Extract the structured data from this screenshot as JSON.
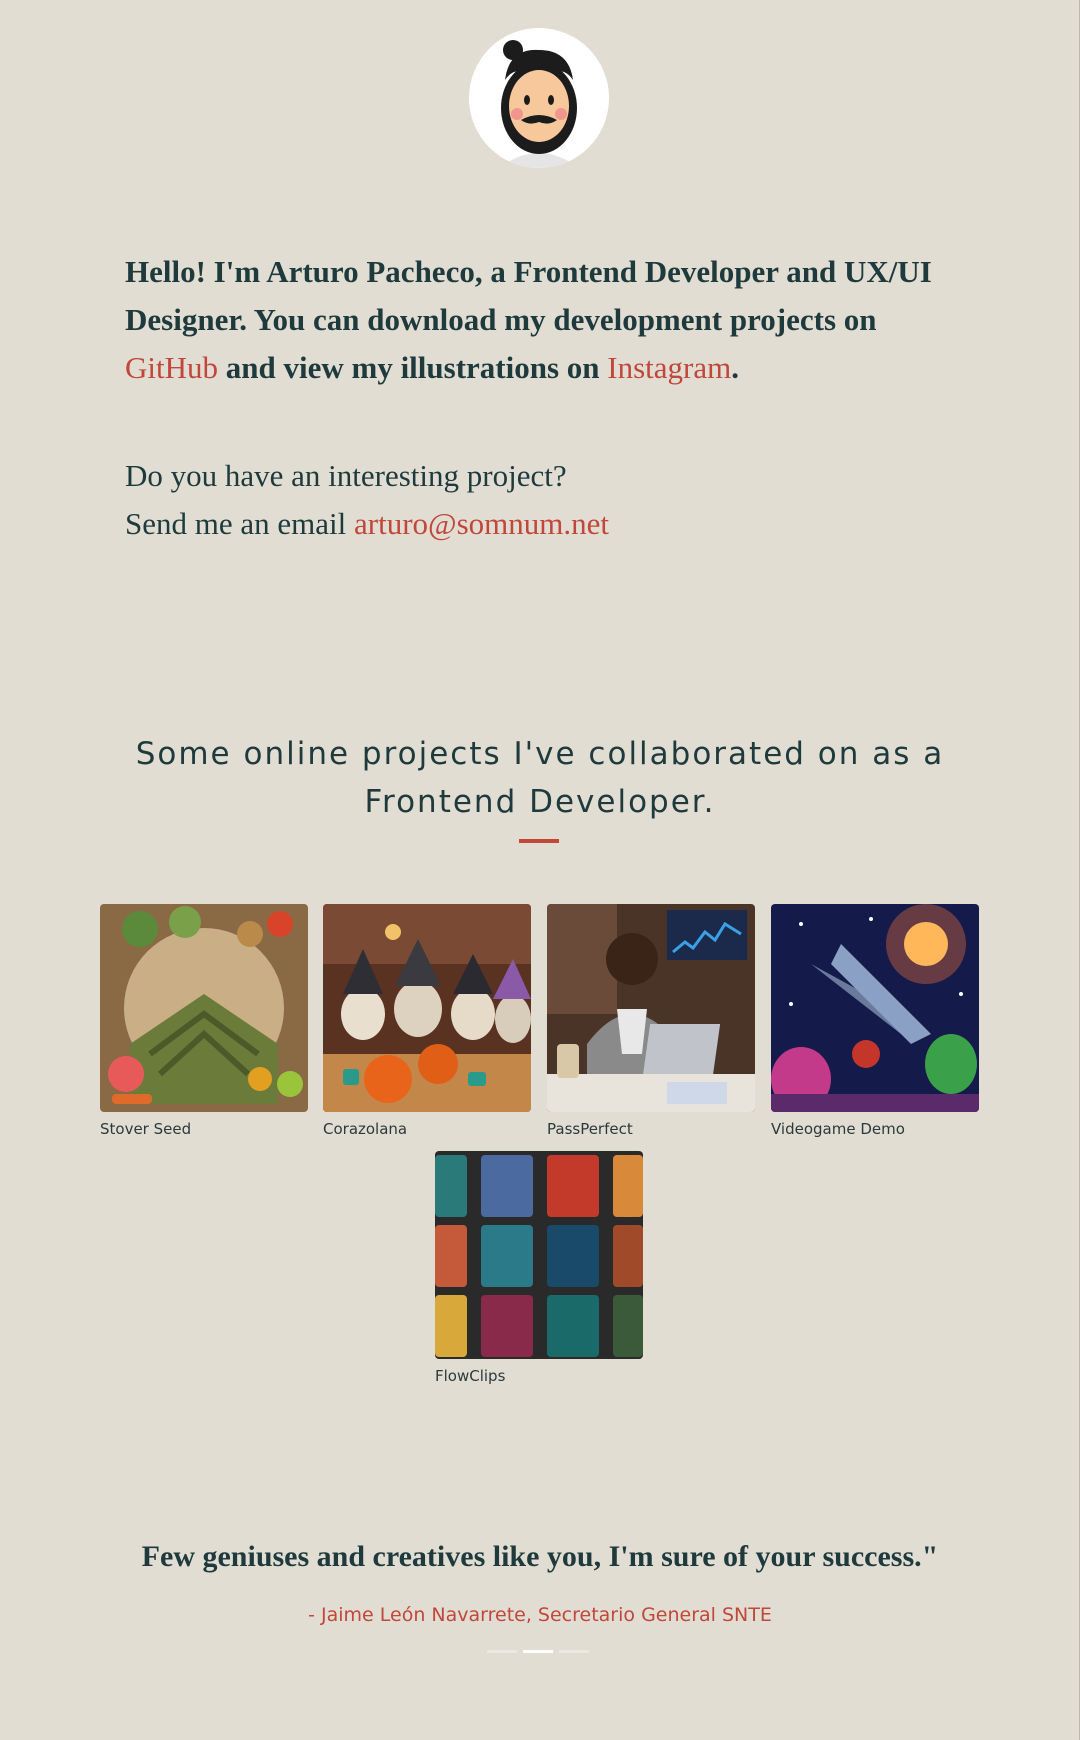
{
  "avatar": {
    "icon": "cartoon-face-avatar"
  },
  "intro": {
    "text_1": "Hello! I'm Arturo Pacheco, a Frontend Developer and UX/UI Designer. You can download my development projects on ",
    "github_link": "GitHub",
    "text_2": " and view my illustrations on ",
    "instagram_link": "Instagram",
    "text_3": "."
  },
  "contact": {
    "question": "Do you have an interesting project?",
    "prompt": "Send me an email ",
    "email": "arturo@somnum.net"
  },
  "projects": {
    "heading": "Some online projects I've collaborated on as a Frontend Developer.",
    "items": [
      {
        "name": "Stover Seed"
      },
      {
        "name": "Corazolana"
      },
      {
        "name": "PassPerfect"
      },
      {
        "name": "Videogame Demo"
      },
      {
        "name": "FlowClips"
      }
    ]
  },
  "testimonial": {
    "quote": "Few geniuses and creatives like you, I'm sure of your success.\"",
    "author": "- Jaime León Navarrete, Secretario General SNTE"
  },
  "colors": {
    "background": "#e2ddd3",
    "text": "#1e3a3d",
    "accent": "#c0473a"
  }
}
